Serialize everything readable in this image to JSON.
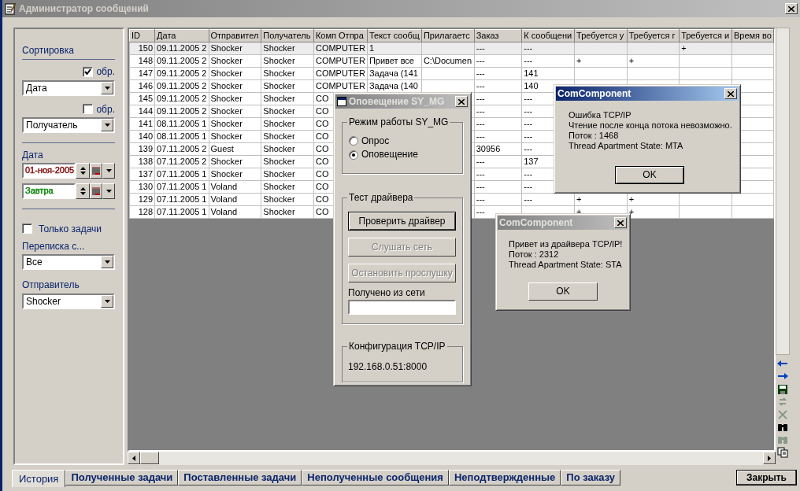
{
  "window": {
    "title": "Администратор сообщений"
  },
  "filters": {
    "sort_title": "Сортировка",
    "sort": [
      {
        "reverse_label": "обр.",
        "checked": true,
        "value": "Дата"
      },
      {
        "reverse_label": "обр.",
        "checked": false,
        "value": "Получатель"
      }
    ],
    "date_title": "Дата",
    "dates": [
      {
        "value": "01-ноя-2005",
        "color": "#800000"
      },
      {
        "value": "Завтра",
        "color": "#008000"
      }
    ],
    "tasks_only": {
      "label": "Только задачи",
      "checked": false
    },
    "correspondence": {
      "label": "Переписка с...",
      "value": "Все"
    },
    "sender": {
      "label": "Отправитель",
      "value": "Shocker"
    }
  },
  "table": {
    "columns": [
      "ID",
      "Дата",
      "Отправител",
      "Получатель",
      "Комп Отпра",
      "Текст сообщ",
      "Прилагаетс",
      "Заказ",
      "К сообщени",
      "Требуется у",
      "Требуется г",
      "Требуется и",
      "Время во"
    ],
    "rows": [
      {
        "selected": true,
        "cells": [
          "150",
          "09.11.2005 2",
          "Shocker",
          "Shocker",
          "COMPUTER",
          "1",
          null,
          "---",
          "---",
          null,
          null,
          "+",
          null
        ]
      },
      {
        "selected": false,
        "cells": [
          "148",
          "09.11.2005 2",
          "Shocker",
          "Shocker",
          "COMPUTER",
          "Привет все",
          "C:\\Documen",
          "---",
          "---",
          "+",
          "+",
          null,
          null
        ]
      },
      {
        "selected": false,
        "cells": [
          "147",
          "09.11.2005 2",
          "Shocker",
          "Shocker",
          "COMPUTER",
          "Задача (141",
          null,
          "---",
          "141",
          null,
          null,
          null,
          null
        ]
      },
      {
        "selected": false,
        "cells": [
          "146",
          "09.11.2005 2",
          "Shocker",
          "Shocker",
          "COMPUTER",
          "Задача (140",
          null,
          "---",
          "140",
          null,
          null,
          null,
          null
        ]
      },
      {
        "selected": false,
        "cells": [
          "145",
          "09.11.2005 2",
          "Shocker",
          "Shocker",
          "CO",
          null,
          null,
          "---",
          "---",
          null,
          null,
          null,
          null
        ]
      },
      {
        "selected": false,
        "cells": [
          "144",
          "09.11.2005 2",
          "Shocker",
          "Shocker",
          "CO",
          null,
          null,
          "---",
          "---",
          null,
          null,
          null,
          null
        ]
      },
      {
        "selected": false,
        "cells": [
          "141",
          "08.11.2005 1",
          "Shocker",
          "Shocker",
          "CO",
          null,
          null,
          "---",
          "---",
          null,
          null,
          null,
          null
        ]
      },
      {
        "selected": false,
        "cells": [
          "140",
          "08.11.2005 1",
          "Shocker",
          "Shocker",
          "CO",
          null,
          null,
          "---",
          "---",
          null,
          null,
          null,
          null
        ]
      },
      {
        "selected": false,
        "cells": [
          "139",
          "07.11.2005 2",
          "Guest",
          "Shocker",
          "CO",
          null,
          null,
          "30956",
          "---",
          null,
          null,
          null,
          null
        ]
      },
      {
        "selected": false,
        "cells": [
          "138",
          "07.11.2005 2",
          "Shocker",
          "Shocker",
          "CO",
          null,
          null,
          "---",
          "137",
          null,
          null,
          null,
          null
        ]
      },
      {
        "selected": false,
        "cells": [
          "137",
          "07.11.2005 1",
          "Shocker",
          "Shocker",
          "CO",
          null,
          null,
          "---",
          "---",
          null,
          null,
          null,
          null
        ]
      },
      {
        "selected": false,
        "cells": [
          "130",
          "07.11.2005 1",
          "Voland",
          "Shocker",
          "CO",
          null,
          null,
          "---",
          "---",
          null,
          null,
          null,
          null
        ]
      },
      {
        "selected": false,
        "cells": [
          "129",
          "07.11.2005 1",
          "Voland",
          "Shocker",
          "CO",
          null,
          null,
          "---",
          "---",
          "+",
          "+",
          null,
          null
        ]
      },
      {
        "selected": false,
        "cells": [
          "128",
          "07.11.2005 1",
          "Voland",
          "Shocker",
          "CO",
          null,
          null,
          "---",
          null,
          "+",
          "+",
          null,
          null
        ]
      }
    ]
  },
  "toolbar": [
    {
      "kind": "back",
      "disabled": false
    },
    {
      "kind": "forward",
      "disabled": false
    },
    {
      "kind": "save",
      "disabled": false
    },
    {
      "kind": "refresh",
      "disabled": true
    },
    {
      "kind": "delete",
      "disabled": true
    },
    {
      "kind": "find",
      "disabled": false
    },
    {
      "kind": "find",
      "disabled": true
    },
    {
      "kind": "copy",
      "disabled": false
    }
  ],
  "tabs": [
    {
      "label": "История",
      "selected": true
    },
    {
      "label": "Полученные задачи",
      "selected": false
    },
    {
      "label": "Поставленные задачи",
      "selected": false
    },
    {
      "label": "Неполученные сообщения",
      "selected": false
    },
    {
      "label": "Неподтвержденные",
      "selected": false
    },
    {
      "label": "По заказу",
      "selected": false
    }
  ],
  "close_button": "Закрыть",
  "notify_dialog": {
    "title": "Оповещение SY_MG",
    "active": false,
    "mode_group": "Режим работы SY_MG",
    "modes": [
      {
        "label": "Опрос",
        "selected": false
      },
      {
        "label": "Оповещение",
        "selected": true
      }
    ],
    "test_group": "Тест драйвера",
    "buttons": [
      {
        "label": "Проверить драйвер",
        "disabled": false
      },
      {
        "label": "Слушать сеть",
        "disabled": true
      },
      {
        "label": "Остановить прослушку",
        "disabled": true
      }
    ],
    "received_label": "Получено из сети",
    "config_group": "Конфигурация TCP/IP",
    "address": "192.168.0.51:8000"
  },
  "dialogs": [
    {
      "title": "ComComponent",
      "active": true,
      "lines": [
        "Ошибка TCP/IP",
        "Чтение после конца потока невозможно.",
        "Поток : 1468",
        "Thread Apartment State: MTA"
      ],
      "button": "OK"
    },
    {
      "title": "ComComponent",
      "active": false,
      "lines": [
        "Привет из драйвера TCP/IP!",
        "Поток : 2312",
        "Thread Apartment State: STA"
      ],
      "button": "OK"
    }
  ]
}
